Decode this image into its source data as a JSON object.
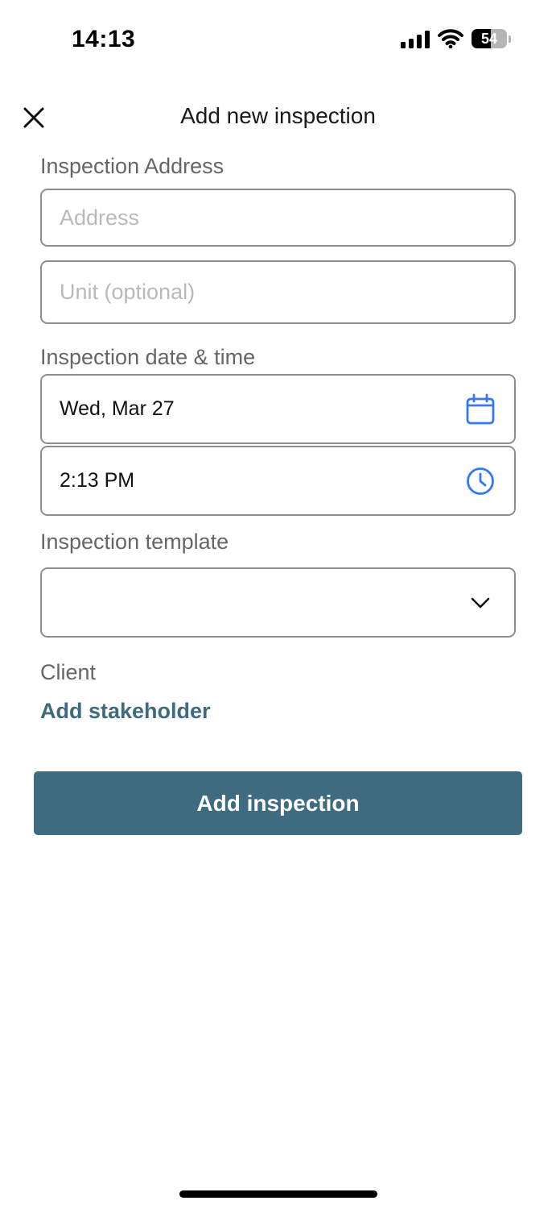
{
  "status_bar": {
    "time": "14:13",
    "battery_level": "54",
    "battery_fraction": 0.54
  },
  "header": {
    "title": "Add new inspection",
    "close_icon": "close-icon"
  },
  "form": {
    "address_section_label": "Inspection Address",
    "address_placeholder": "Address",
    "unit_placeholder": "Unit (optional)",
    "datetime_section_label": "Inspection date & time",
    "date_value": "Wed, Mar 27",
    "date_icon": "calendar-icon",
    "time_value": "2:13 PM",
    "time_icon": "clock-icon",
    "template_section_label": "Inspection template",
    "template_value": "",
    "template_icon": "chevron-down-icon",
    "client_label": "Client",
    "add_stakeholder_link": "Add stakeholder",
    "submit_button": "Add inspection"
  },
  "colors": {
    "accent": "#3e6b80",
    "icon_blue": "#3478f6",
    "label_gray": "#666666",
    "border_gray": "#8e8e8e"
  }
}
